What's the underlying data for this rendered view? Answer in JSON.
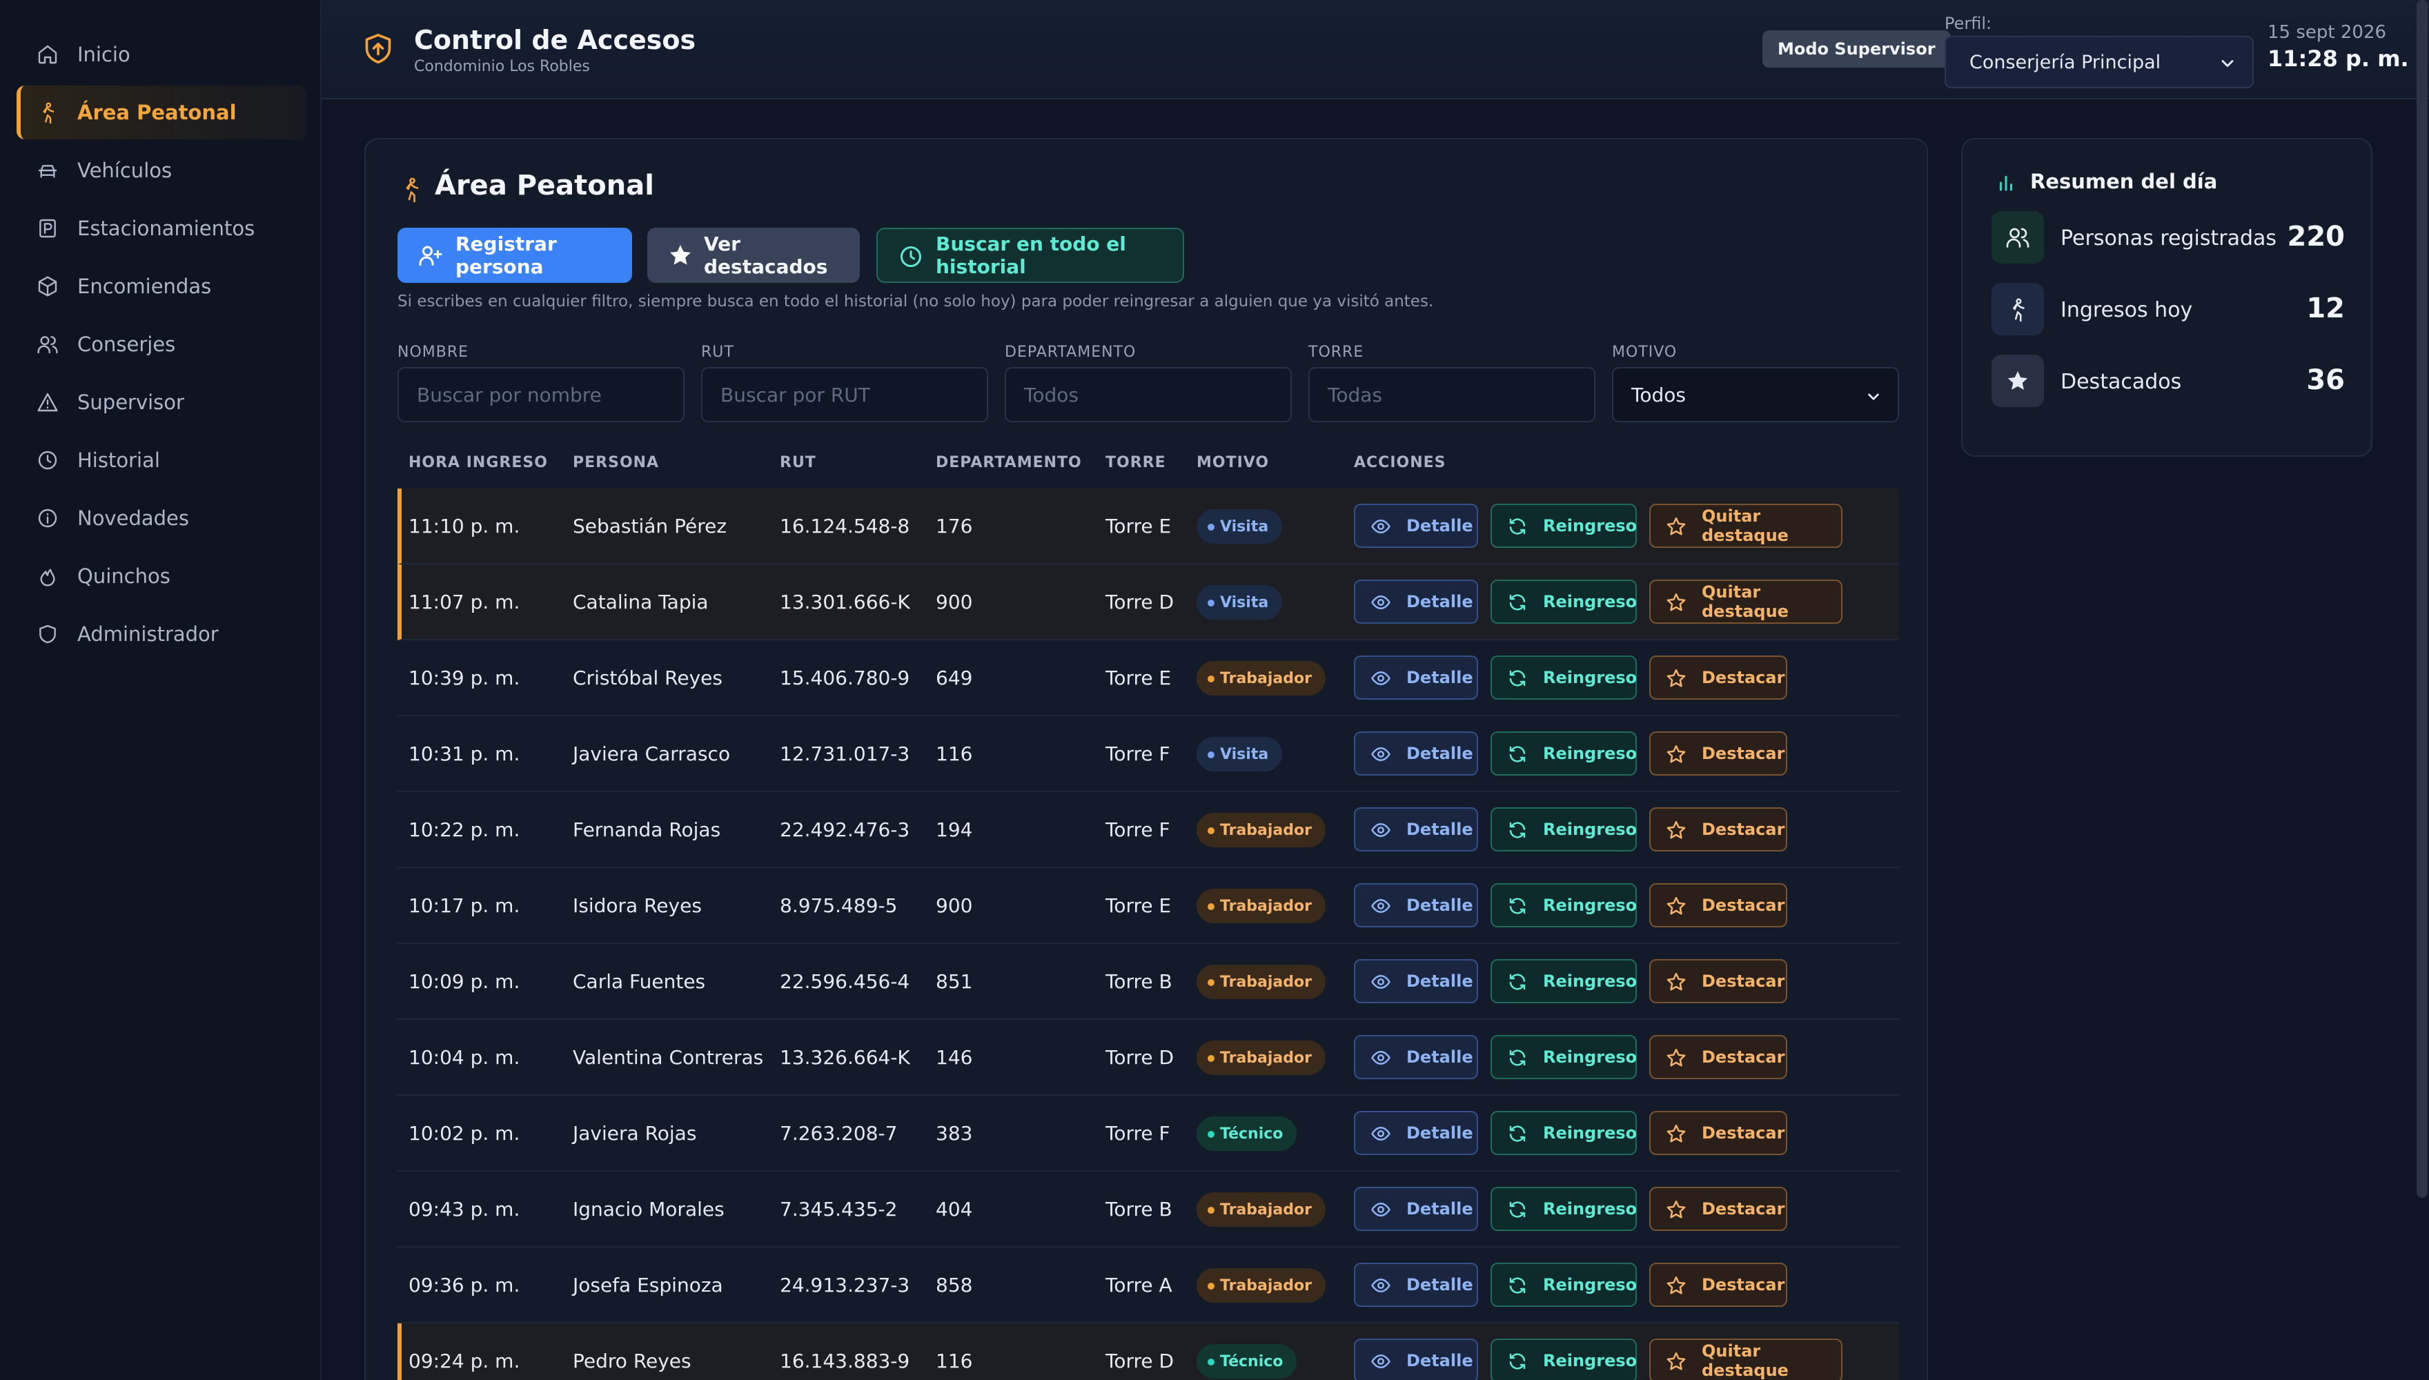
{
  "sidebar": {
    "items": [
      {
        "label": "Inicio",
        "icon": "home-icon"
      },
      {
        "label": "Área Peatonal",
        "icon": "walking-icon",
        "active": true
      },
      {
        "label": "Vehículos",
        "icon": "car-icon"
      },
      {
        "label": "Estacionamientos",
        "icon": "parking-icon"
      },
      {
        "label": "Encomiendas",
        "icon": "package-icon"
      },
      {
        "label": "Conserjes",
        "icon": "users-icon"
      },
      {
        "label": "Supervisor",
        "icon": "warning-icon"
      },
      {
        "label": "Historial",
        "icon": "clock-icon"
      },
      {
        "label": "Novedades",
        "icon": "info-icon"
      },
      {
        "label": "Quinchos",
        "icon": "flame-icon"
      },
      {
        "label": "Administrador",
        "icon": "shield-icon"
      }
    ]
  },
  "header": {
    "title": "Control de Accesos",
    "subtitle": "Condominio Los Robles",
    "mode_badge": "Modo Supervisor",
    "profile_label": "Perfil:",
    "profile_value": "Conserjería Principal",
    "date": "15 sept 2026",
    "time": "11:28 p. m."
  },
  "main": {
    "title": "Área Peatonal",
    "buttons": {
      "register": "Registrar persona",
      "featured": "Ver destacados",
      "search_history": "Buscar en todo el historial"
    },
    "hint": "Si escribes en cualquier filtro, siempre busca en todo el historial (no solo hoy) para poder reingresar a alguien que ya visitó antes.",
    "filters": {
      "nombre": {
        "label": "NOMBRE",
        "placeholder": "Buscar por nombre"
      },
      "rut": {
        "label": "RUT",
        "placeholder": "Buscar por RUT"
      },
      "departamento": {
        "label": "DEPARTAMENTO",
        "placeholder": "Todos"
      },
      "torre": {
        "label": "TORRE",
        "placeholder": "Todas"
      },
      "motivo": {
        "label": "MOTIVO",
        "value": "Todos"
      }
    },
    "columns": [
      "HORA INGRESO",
      "PERSONA",
      "RUT",
      "DEPARTAMENTO",
      "TORRE",
      "MOTIVO",
      "ACCIONES"
    ],
    "actions": {
      "detail": "Detalle",
      "reentry": "Reingreso",
      "feature": "Destacar",
      "unfeature": "Quitar destaque"
    },
    "rows": [
      {
        "time": "11:10 p. m.",
        "name": "Sebastián Pérez",
        "rut": "16.124.548-8",
        "dept": "176",
        "tower": "Torre E",
        "reason": "Visita",
        "kind": "visita",
        "featured": true
      },
      {
        "time": "11:07 p. m.",
        "name": "Catalina Tapia",
        "rut": "13.301.666-K",
        "dept": "900",
        "tower": "Torre D",
        "reason": "Visita",
        "kind": "visita",
        "featured": true
      },
      {
        "time": "10:39 p. m.",
        "name": "Cristóbal Reyes",
        "rut": "15.406.780-9",
        "dept": "649",
        "tower": "Torre E",
        "reason": "Trabajador",
        "kind": "trabajador",
        "featured": false
      },
      {
        "time": "10:31 p. m.",
        "name": "Javiera Carrasco",
        "rut": "12.731.017-3",
        "dept": "116",
        "tower": "Torre F",
        "reason": "Visita",
        "kind": "visita",
        "featured": false
      },
      {
        "time": "10:22 p. m.",
        "name": "Fernanda Rojas",
        "rut": "22.492.476-3",
        "dept": "194",
        "tower": "Torre F",
        "reason": "Trabajador",
        "kind": "trabajador",
        "featured": false
      },
      {
        "time": "10:17 p. m.",
        "name": "Isidora Reyes",
        "rut": "8.975.489-5",
        "dept": "900",
        "tower": "Torre E",
        "reason": "Trabajador",
        "kind": "trabajador",
        "featured": false
      },
      {
        "time": "10:09 p. m.",
        "name": "Carla Fuentes",
        "rut": "22.596.456-4",
        "dept": "851",
        "tower": "Torre B",
        "reason": "Trabajador",
        "kind": "trabajador",
        "featured": false
      },
      {
        "time": "10:04 p. m.",
        "name": "Valentina Contreras",
        "rut": "13.326.664-K",
        "dept": "146",
        "tower": "Torre D",
        "reason": "Trabajador",
        "kind": "trabajador",
        "featured": false
      },
      {
        "time": "10:02 p. m.",
        "name": "Javiera Rojas",
        "rut": "7.263.208-7",
        "dept": "383",
        "tower": "Torre F",
        "reason": "Técnico",
        "kind": "tecnico",
        "featured": false
      },
      {
        "time": "09:43 p. m.",
        "name": "Ignacio Morales",
        "rut": "7.345.435-2",
        "dept": "404",
        "tower": "Torre B",
        "reason": "Trabajador",
        "kind": "trabajador",
        "featured": false
      },
      {
        "time": "09:36 p. m.",
        "name": "Josefa Espinoza",
        "rut": "24.913.237-3",
        "dept": "858",
        "tower": "Torre A",
        "reason": "Trabajador",
        "kind": "trabajador",
        "featured": false
      },
      {
        "time": "09:24 p. m.",
        "name": "Pedro Reyes",
        "rut": "16.143.883-9",
        "dept": "116",
        "tower": "Torre D",
        "reason": "Técnico",
        "kind": "tecnico",
        "featured": true
      }
    ]
  },
  "summary": {
    "title": "Resumen del día",
    "items": [
      {
        "label": "Personas registradas",
        "value": "220",
        "icon": "users-icon"
      },
      {
        "label": "Ingresos hoy",
        "value": "12",
        "icon": "walking-icon"
      },
      {
        "label": "Destacados",
        "value": "36",
        "icon": "star-icon"
      }
    ]
  },
  "colors": {
    "accent": "#f0a13a",
    "primary": "#3b82f6",
    "teal": "#2dd4bf",
    "background": "#0f1524"
  }
}
